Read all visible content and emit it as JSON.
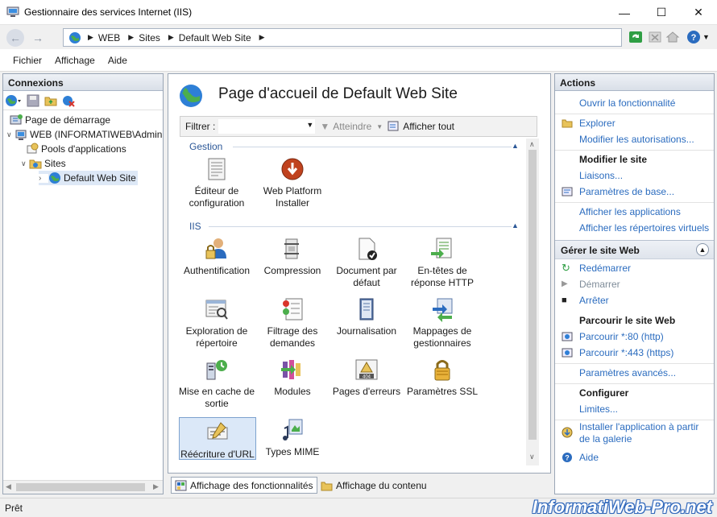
{
  "window": {
    "title": "Gestionnaire des services Internet (IIS)"
  },
  "address": {
    "crumbs": [
      "WEB",
      "Sites",
      "Default Web Site"
    ]
  },
  "menu": [
    "Fichier",
    "Affichage",
    "Aide"
  ],
  "connections": {
    "title": "Connexions",
    "tree": [
      "Page de démarrage",
      "WEB (INFORMATIWEB\\Admin",
      "Pools d'applications",
      "Sites",
      "Default Web Site"
    ]
  },
  "center": {
    "title": "Page d'accueil de Default Web Site",
    "filter_label": "Filtrer :",
    "goto_label": "Atteindre",
    "show_all_label": "Afficher tout",
    "groups": [
      {
        "name": "Gestion",
        "items": [
          "Éditeur de configuration",
          "Web Platform Installer"
        ]
      },
      {
        "name": "IIS",
        "items": [
          "Authentification",
          "Compression",
          "Document par défaut",
          "En-têtes de réponse HTTP",
          "Exploration de répertoire",
          "Filtrage des demandes",
          "Journalisation",
          "Mappages de gestionnaires",
          "Mise en cache de sortie",
          "Modules",
          "Pages d'erreurs",
          "Paramètres SSL",
          "Réécriture d'URL",
          "Types MIME"
        ]
      }
    ],
    "tabs": [
      "Affichage des fonctionnalités",
      "Affichage du contenu"
    ]
  },
  "actions": {
    "title": "Actions",
    "open_feature": "Ouvrir la fonctionnalité",
    "explore": "Explorer",
    "edit_permissions": "Modifier les autorisations...",
    "edit_site_header": "Modifier le site",
    "bindings": "Liaisons...",
    "basic_settings": "Paramètres de base...",
    "view_apps": "Afficher les applications",
    "view_vdirs": "Afficher les répertoires virtuels",
    "manage_section": "Gérer le site Web",
    "restart": "Redémarrer",
    "start": "Démarrer",
    "stop": "Arrêter",
    "browse_header": "Parcourir le site Web",
    "browse_80": "Parcourir *:80 (http)",
    "browse_443": "Parcourir *:443 (https)",
    "advanced": "Paramètres avancés...",
    "configure_header": "Configurer",
    "limits": "Limites...",
    "install_gallery": "Installer l'application à partir de la galerie",
    "help": "Aide"
  },
  "status": {
    "text": "Prêt",
    "watermark": "InformatiWeb-Pro.net"
  }
}
